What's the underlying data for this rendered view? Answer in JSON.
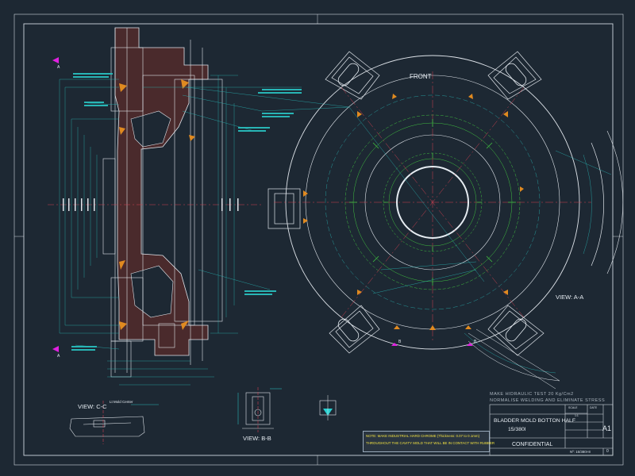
{
  "views": {
    "front_label": "FRONT",
    "view_aa": "VIEW: A-A",
    "view_bb": "VIEW: B-B",
    "view_cc": "VIEW: C-C",
    "section_a": "A",
    "section_b": "B",
    "mold_center": "Lt Mold Center"
  },
  "notes": {
    "hydraulic_test": "MAKE HIDRAULIC TEST  20 Kg/Cm2",
    "normalise": "NORMALISE WELDING AND ELIMINATE STRESS",
    "chrome_note_1": "NOTE: MAKE INDUSTRIAL HARD CHROME (Thickness: 0.07 to 0.1mm)",
    "chrome_note_2": "THROUGHOUT THE CAVITY MOLD THAT WILL BE IN CONTACT WITH RUBBER"
  },
  "title_block": {
    "title_line_1": "BLADDER MOLD BOTTON HALF",
    "title_line_2": "15/380I",
    "scale_label": "SCALE",
    "scale_value": "1:1",
    "date_label": "DATE",
    "sheet_size": "A1",
    "confidential": "CONFIDENTIAL",
    "drawing_number": "Nº: 15/380I-8",
    "revision": "0"
  },
  "colors": {
    "background": "#1d2833",
    "frame": "#cfd6dd",
    "geometry": "#dfe4ea",
    "centerline": "#d04050",
    "dimension": "#28b5b5",
    "weld": "#e08a20",
    "green_line": "#40c040",
    "section_marker": "#e020e0",
    "part_fill": "#4a2a2c"
  }
}
